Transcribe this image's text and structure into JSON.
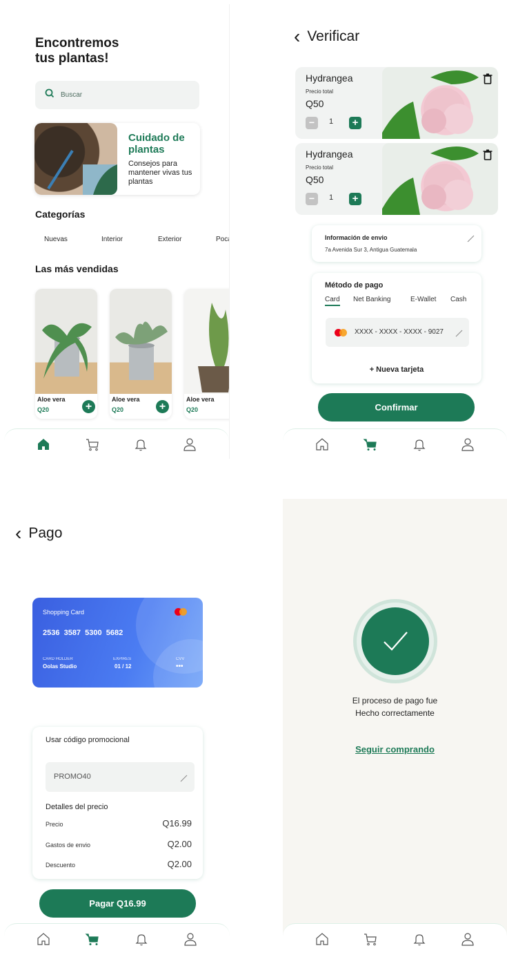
{
  "home": {
    "title_line1": "Encontremos",
    "title_line2": "tus plantas!",
    "search_placeholder": "Buscar",
    "care_card": {
      "title": "Cuidado de plantas",
      "subtitle": "Consejos para mantener vivas tus plantas"
    },
    "categories_title": "Categorías",
    "categories": [
      "Nuevas",
      "Interior",
      "Exterior",
      "Poca"
    ],
    "bestsellers_title": "Las más vendidas",
    "products": [
      {
        "name": "Aloe vera",
        "price": "Q20"
      },
      {
        "name": "Aloe vera",
        "price": "Q20"
      },
      {
        "name": "Aloe vera",
        "price": "Q20"
      }
    ],
    "plus_symbol": "+"
  },
  "verify": {
    "back_symbol": "‹",
    "title": "Verificar",
    "items": [
      {
        "name": "Hydrangea",
        "price_label": "Precio total",
        "price": "Q50",
        "qty": "1"
      },
      {
        "name": "Hydrangea",
        "price_label": "Precio total",
        "price": "Q50",
        "qty": "1"
      }
    ],
    "minus_symbol": "−",
    "plus_symbol": "+",
    "shipping": {
      "label": "Información de envio",
      "address": "7a Avenida Sur 3, Antigua Guatemala"
    },
    "payment": {
      "title": "Método de pago",
      "tabs": [
        "Card",
        "Net Banking",
        "E-Wallet",
        "Cash"
      ],
      "active_tab": "Card",
      "card_number": "XXXX - XXXX - XXXX - 9027",
      "new_card": "+ Nueva tarjeta"
    },
    "confirm_label": "Confirmar"
  },
  "payment_screen": {
    "back_symbol": "‹",
    "title": "Pago",
    "card": {
      "label": "Shopping Card",
      "number": "2536  3587  5300  5682",
      "holder_label": "CARD HOLDER",
      "holder": "Oolas Studio",
      "expires_label": "EXPIRES",
      "expires": "01 / 12",
      "cvv_label": "CVV",
      "cvv": "•••"
    },
    "promo_title": "Usar código promocional",
    "promo_code": "PROMO40",
    "details_title": "Detalles del precio",
    "rows": [
      {
        "label": "Precio",
        "value": "Q16.99"
      },
      {
        "label": "Gastos de envio",
        "value": "Q2.00"
      },
      {
        "label": "Descuento",
        "value": "Q2.00"
      }
    ],
    "pay_label": "Pagar Q16.99"
  },
  "success": {
    "message_line1": "El proceso de pago fue",
    "message_line2": "Hecho correctamente",
    "link": "Seguir comprando"
  },
  "colors": {
    "accent": "#1d7a57",
    "card_blue": "#3a5fe0",
    "surface": "#f1f3f2"
  }
}
